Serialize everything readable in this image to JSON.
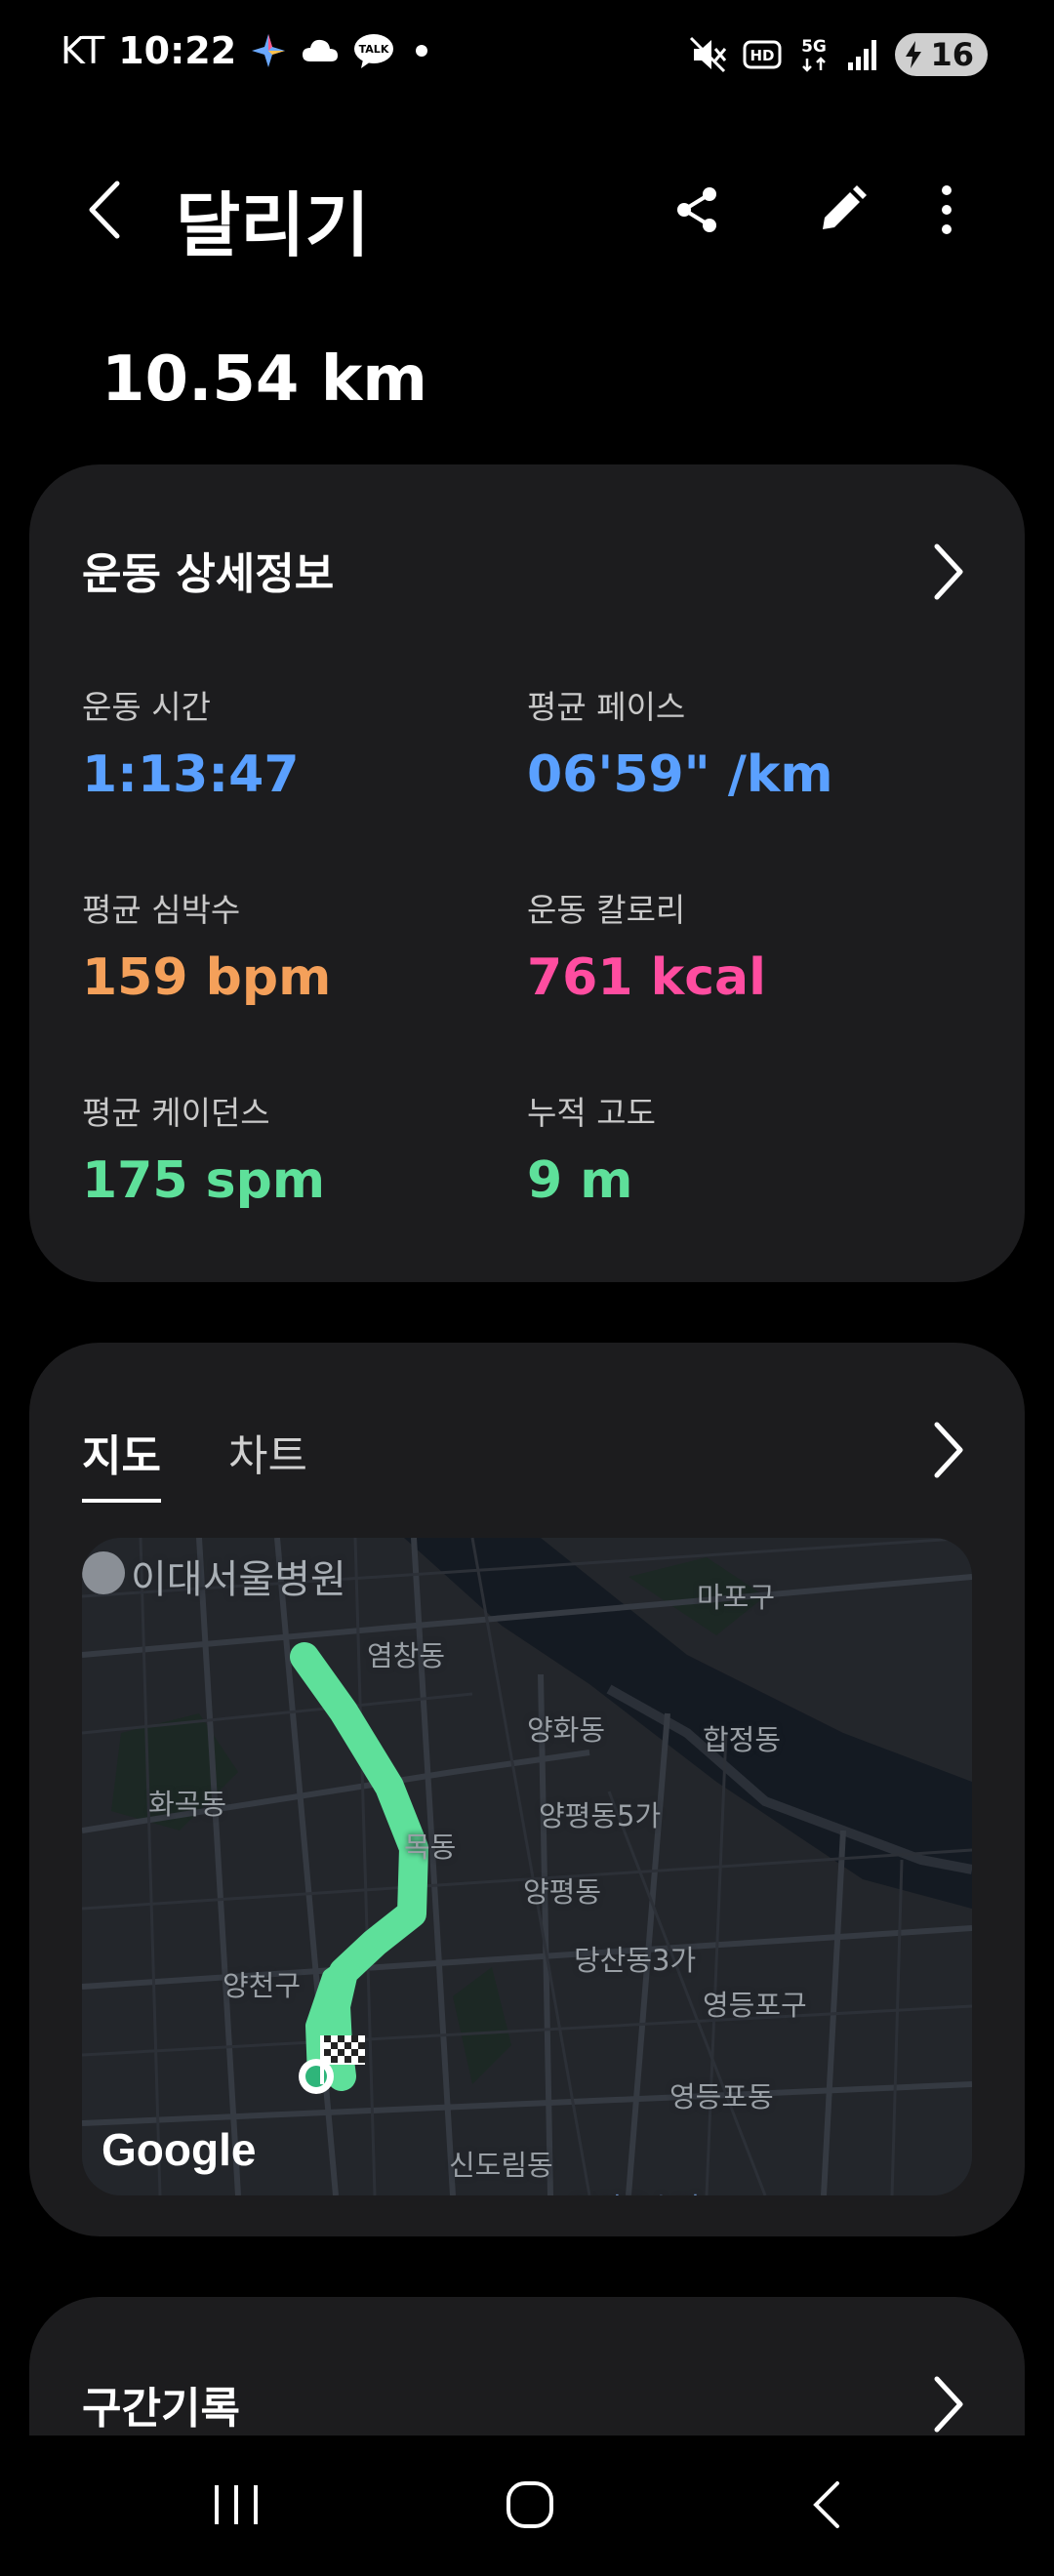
{
  "status_bar": {
    "carrier": "KT",
    "time": "10:22",
    "battery": "16",
    "icons": [
      "ai-sparkle-icon",
      "cloud-icon",
      "talk-icon",
      "notification-dot-icon",
      "mute-icon",
      "hd-icon",
      "5g-icon",
      "signal-icon",
      "battery-charging-icon"
    ],
    "talk_label": "TALK",
    "hd_label": "HD",
    "net_label": "5G"
  },
  "header": {
    "title": "달리기",
    "icons": [
      "back-icon",
      "share-icon",
      "edit-icon",
      "more-icon"
    ]
  },
  "distance": "10.54 km",
  "details_card": {
    "title": "운동 상세정보",
    "metrics": [
      {
        "label": "운동 시간",
        "value": "1:13:47",
        "color": "#5aa0ff"
      },
      {
        "label": "평균 페이스",
        "value": "06'59\" /km",
        "color": "#5aa0ff"
      },
      {
        "label": "평균 심박수",
        "value": "159 bpm",
        "color": "#f4a05a"
      },
      {
        "label": "운동 칼로리",
        "value": "761 kcal",
        "color": "#ff4da0"
      },
      {
        "label": "평균 케이던스",
        "value": "175 spm",
        "color": "#5ee09a"
      },
      {
        "label": "누적 고도",
        "value": "9 m",
        "color": "#5ee09a"
      }
    ]
  },
  "map_card": {
    "tabs": [
      {
        "label": "지도",
        "active": true
      },
      {
        "label": "차트",
        "active": false
      }
    ],
    "map_labels": [
      "이대서울병원",
      "마포구",
      "염창동",
      "양화동",
      "합정동",
      "화곡동",
      "양평동5가",
      "목동",
      "양평동",
      "당산동3가",
      "양천구",
      "영등포구",
      "영등포동",
      "신도림동",
      "도림유수지"
    ],
    "attribution": "Google",
    "route_color": "#5ee09a"
  },
  "splits_card": {
    "title": "구간기록"
  },
  "nav_bar": {
    "icons": [
      "recent-apps-icon",
      "home-icon",
      "back-nav-icon"
    ]
  }
}
